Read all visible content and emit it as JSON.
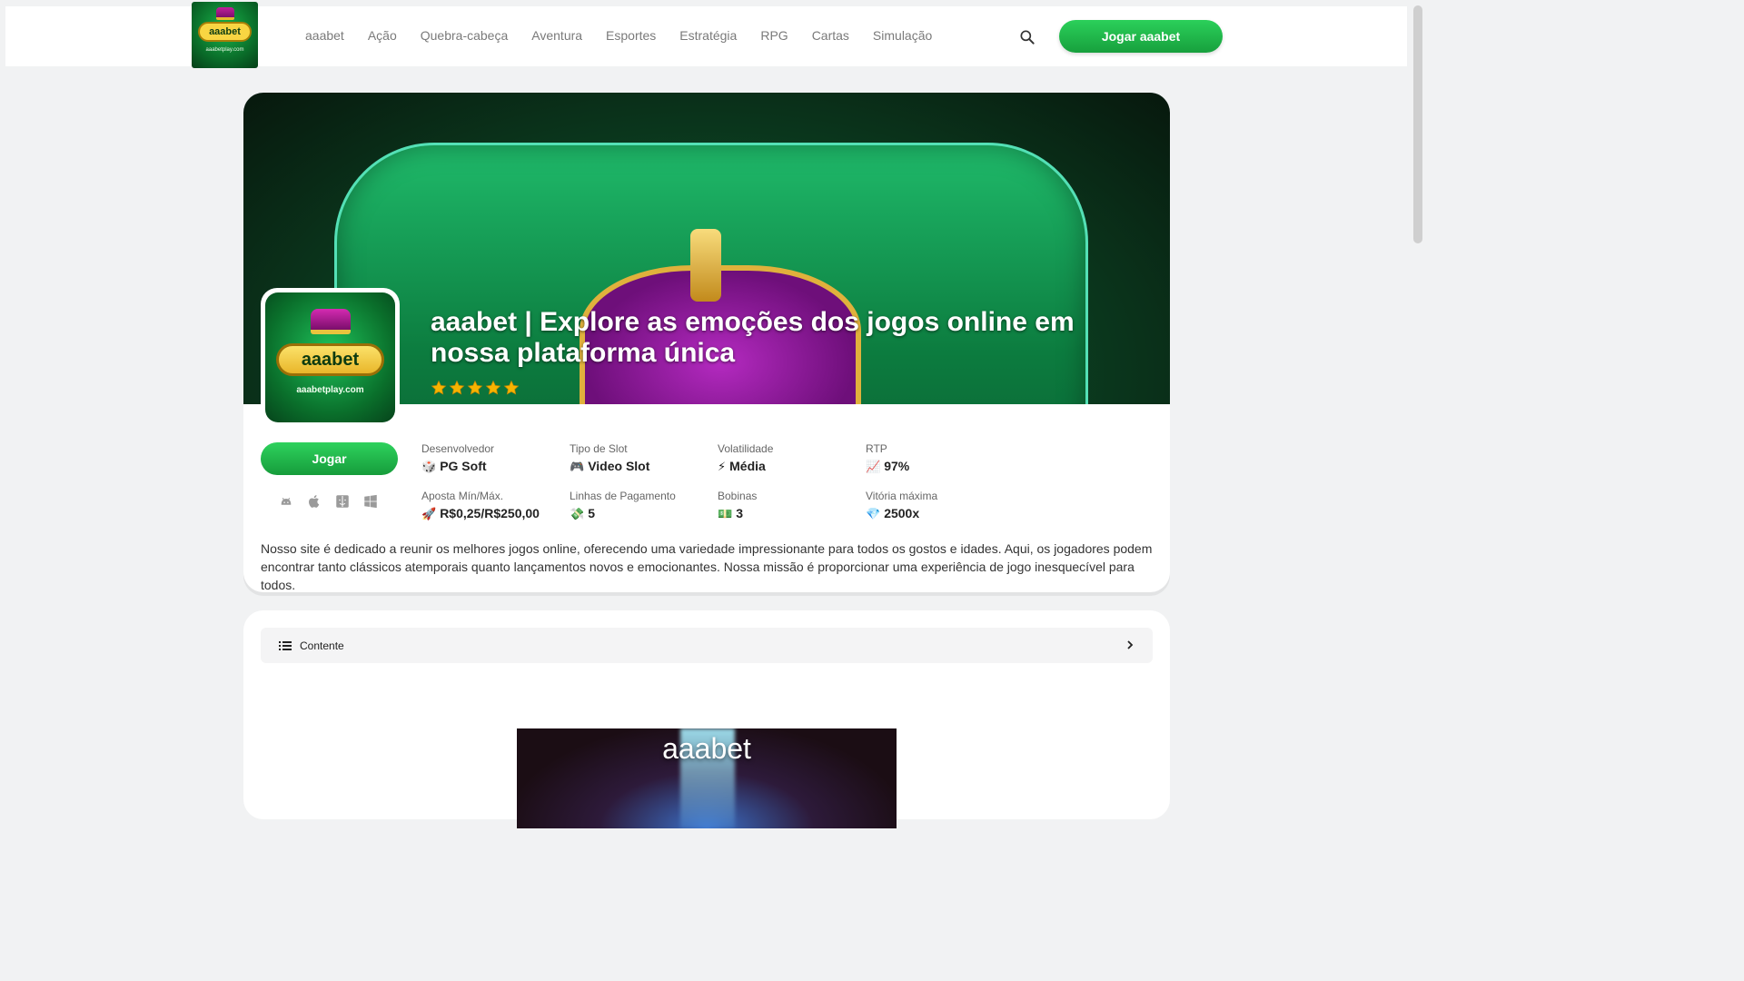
{
  "header": {
    "logo_text": "aaabet",
    "logo_site": "aaabetplay.com",
    "nav": [
      "aaabet",
      "Ação",
      "Quebra-cabeça",
      "Aventura",
      "Esportes",
      "Estratégia",
      "RPG",
      "Cartas",
      "Simulação"
    ],
    "cta": "Jogar aaabet",
    "search_icon": "search-icon"
  },
  "hero": {
    "title": "aaabet | Explore as emoções dos jogos online em nossa plataforma única",
    "rating": 5,
    "app_icon_text": "aaabet",
    "app_icon_site": "aaabetplay.com",
    "play_button": "Jogar",
    "platforms": [
      "android-icon",
      "apple-icon",
      "mac-finder-icon",
      "windows-icon"
    ]
  },
  "stats": [
    {
      "label": "Desenvolvedor",
      "icon": "🎲",
      "value": "PG Soft"
    },
    {
      "label": "Tipo de Slot",
      "icon": "🎮",
      "value": "Video Slot"
    },
    {
      "label": "Volatilidade",
      "icon": "⚡",
      "value": "Média"
    },
    {
      "label": "RTP",
      "icon": "📈",
      "value": "97%"
    },
    {
      "label": "Aposta Mín/Máx.",
      "icon": "🚀",
      "value": "R$0,25/R$250,00"
    },
    {
      "label": "Linhas de Pagamento",
      "icon": "💸",
      "value": "5"
    },
    {
      "label": "Bobinas",
      "icon": "💵",
      "value": "3"
    },
    {
      "label": "Vitória máxima",
      "icon": "💎",
      "value": "2500x"
    }
  ],
  "description": "Nosso site é dedicado a reunir os melhores jogos online, oferecendo uma variedade impressionante para todos os gostos e idades. Aqui, os jogadores podem encontrar tanto clássicos atemporais quanto lançamentos novos e emocionantes. Nossa missão é proporcionar uma experiência de jogo inesquecível para todos.",
  "toc": {
    "label": "Contente"
  },
  "promo": {
    "title": "aaabet"
  },
  "colors": {
    "accent": "#1fb44a",
    "star": "#f6b400"
  }
}
